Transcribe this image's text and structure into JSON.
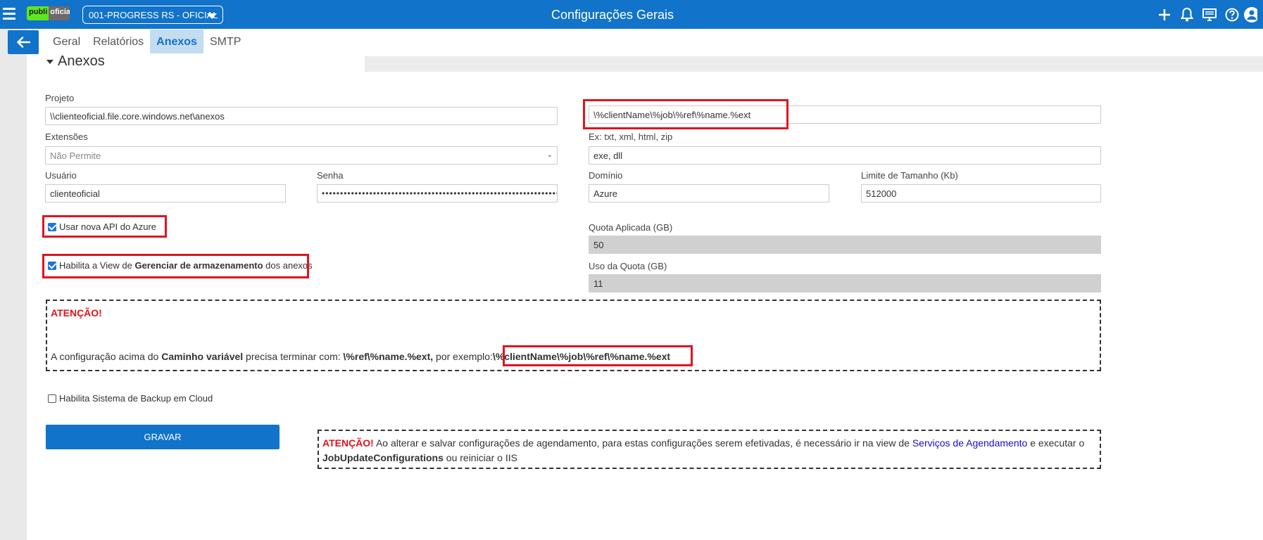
{
  "header": {
    "logo_left": "publi",
    "logo_right": "oficial",
    "company": "001-PROGRESS RS - OFICIAL",
    "title": "Configurações Gerais"
  },
  "icons": {
    "menu": "hamburger-icon",
    "back": "arrow-left-icon",
    "add": "plus-icon",
    "notifications": "bell-icon",
    "display": "monitor-icon",
    "help": "help-icon",
    "user": "user-avatar-icon"
  },
  "colors": {
    "primary": "#1173c9",
    "alert": "#e0141e",
    "highlight_box": "#e0141e"
  },
  "tabs": [
    {
      "label": "Geral",
      "active": false
    },
    {
      "label": "Relatórios",
      "active": false
    },
    {
      "label": "Anexos",
      "active": true
    },
    {
      "label": "SMTP",
      "active": false
    }
  ],
  "section": {
    "title": "Anexos"
  },
  "form": {
    "projeto_label": "Projeto",
    "projeto_value": "\\\\clienteoficial.file.core.windows.net\\anexos",
    "caminho_value": "\\%clientName\\%job\\%ref\\%name.%ext",
    "extensoes_label": "Extensões",
    "extensoes_value": "Não Permite",
    "ext_hint_label": "Ex: txt, xml, html, zip",
    "ext_hint_value": "exe, dll",
    "usuario_label": "Usuário",
    "usuario_value": "clienteoficial",
    "senha_label": "Senha",
    "senha_value": "••••••••••••••••••••••••••••••••••••••••••••••••••••••••••••••••••••••••••••",
    "dominio_label": "Domínio",
    "dominio_value": "Azure",
    "limite_label": "Limite de Tamanho (Kb)",
    "limite_value": "512000",
    "usar_api_label": "Usar nova API do Azure",
    "usar_api_checked": true,
    "habilita_view_prefix": "Habilita a View de",
    "habilita_view_bold": "Gerenciar de armazenamento",
    "habilita_view_suffix": "dos anexos",
    "habilita_view_checked": true,
    "quota_aplicada_label": "Quota Aplicada (GB)",
    "quota_aplicada_value": "50",
    "uso_quota_label": "Uso da Quota (GB)",
    "uso_quota_value": "11",
    "backup_label": "Habilita Sistema de Backup em Cloud",
    "backup_checked": false
  },
  "alert1": {
    "title": "ATENÇÃO!",
    "t1": "A configuração acima do",
    "t2": "Caminho variável",
    "t3": "precisa terminar com:",
    "t4": "\\%ref\\%name.%ext,",
    "t5": "por exemplo:",
    "t6": "\\%clientName\\%job\\%ref\\%name.%ext"
  },
  "save_label": "GRAVAR",
  "alert2": {
    "title": "ATENÇÃO!",
    "t1": "Ao alterar e salvar configurações de agendamento, para estas configurações serem efetivadas, é necessário ir na view de",
    "link": "Serviços de Agendamento",
    "t2": "e executar o",
    "bold": "JobUpdateConfigurations",
    "t3": "ou reiniciar o IIS"
  }
}
